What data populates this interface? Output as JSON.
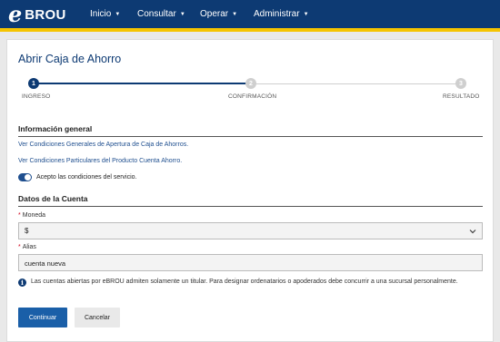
{
  "header": {
    "logo_mark": "e",
    "logo_text": "BROU",
    "nav": [
      {
        "label": "Inicio"
      },
      {
        "label": "Consultar"
      },
      {
        "label": "Operar"
      },
      {
        "label": "Administrar"
      }
    ],
    "caret": "▼"
  },
  "page": {
    "title": "Abrir Caja de Ahorro"
  },
  "stepper": {
    "steps": [
      {
        "number": "1",
        "label": "INGRESO",
        "state": "active"
      },
      {
        "number": "2",
        "label": "CONFIRMACIÓN",
        "state": "pending"
      },
      {
        "number": "3",
        "label": "RESULTADO",
        "state": "pending"
      }
    ]
  },
  "general": {
    "title": "Información general",
    "link_general": "Ver Condiciones Generales de Apertura de Caja de Ahorros.",
    "link_particular": "Ver Condiciones Particulares del Producto Cuenta Ahorro.",
    "accept_label": "Acepto las condiciones del servicio.",
    "accept_checked": true
  },
  "account": {
    "title": "Datos de la Cuenta",
    "required_mark": "*",
    "currency_label": "Moneda",
    "currency_value": "$",
    "alias_label": "Alias",
    "alias_value": "cuenta nueva",
    "info_mark": "i",
    "info_text": "Las cuentas abiertas por eBROU admiten solamente un titular. Para designar ordenatarios o apoderados debe concurrir a una sucursal personalmente."
  },
  "actions": {
    "continue_label": "Continuar",
    "cancel_label": "Cancelar"
  },
  "colors": {
    "header_bg": "#0d3a73",
    "accent_stripe": "#f5c400",
    "primary": "#1a5fa8",
    "link": "#1f4f8f",
    "required": "#d0021b"
  }
}
